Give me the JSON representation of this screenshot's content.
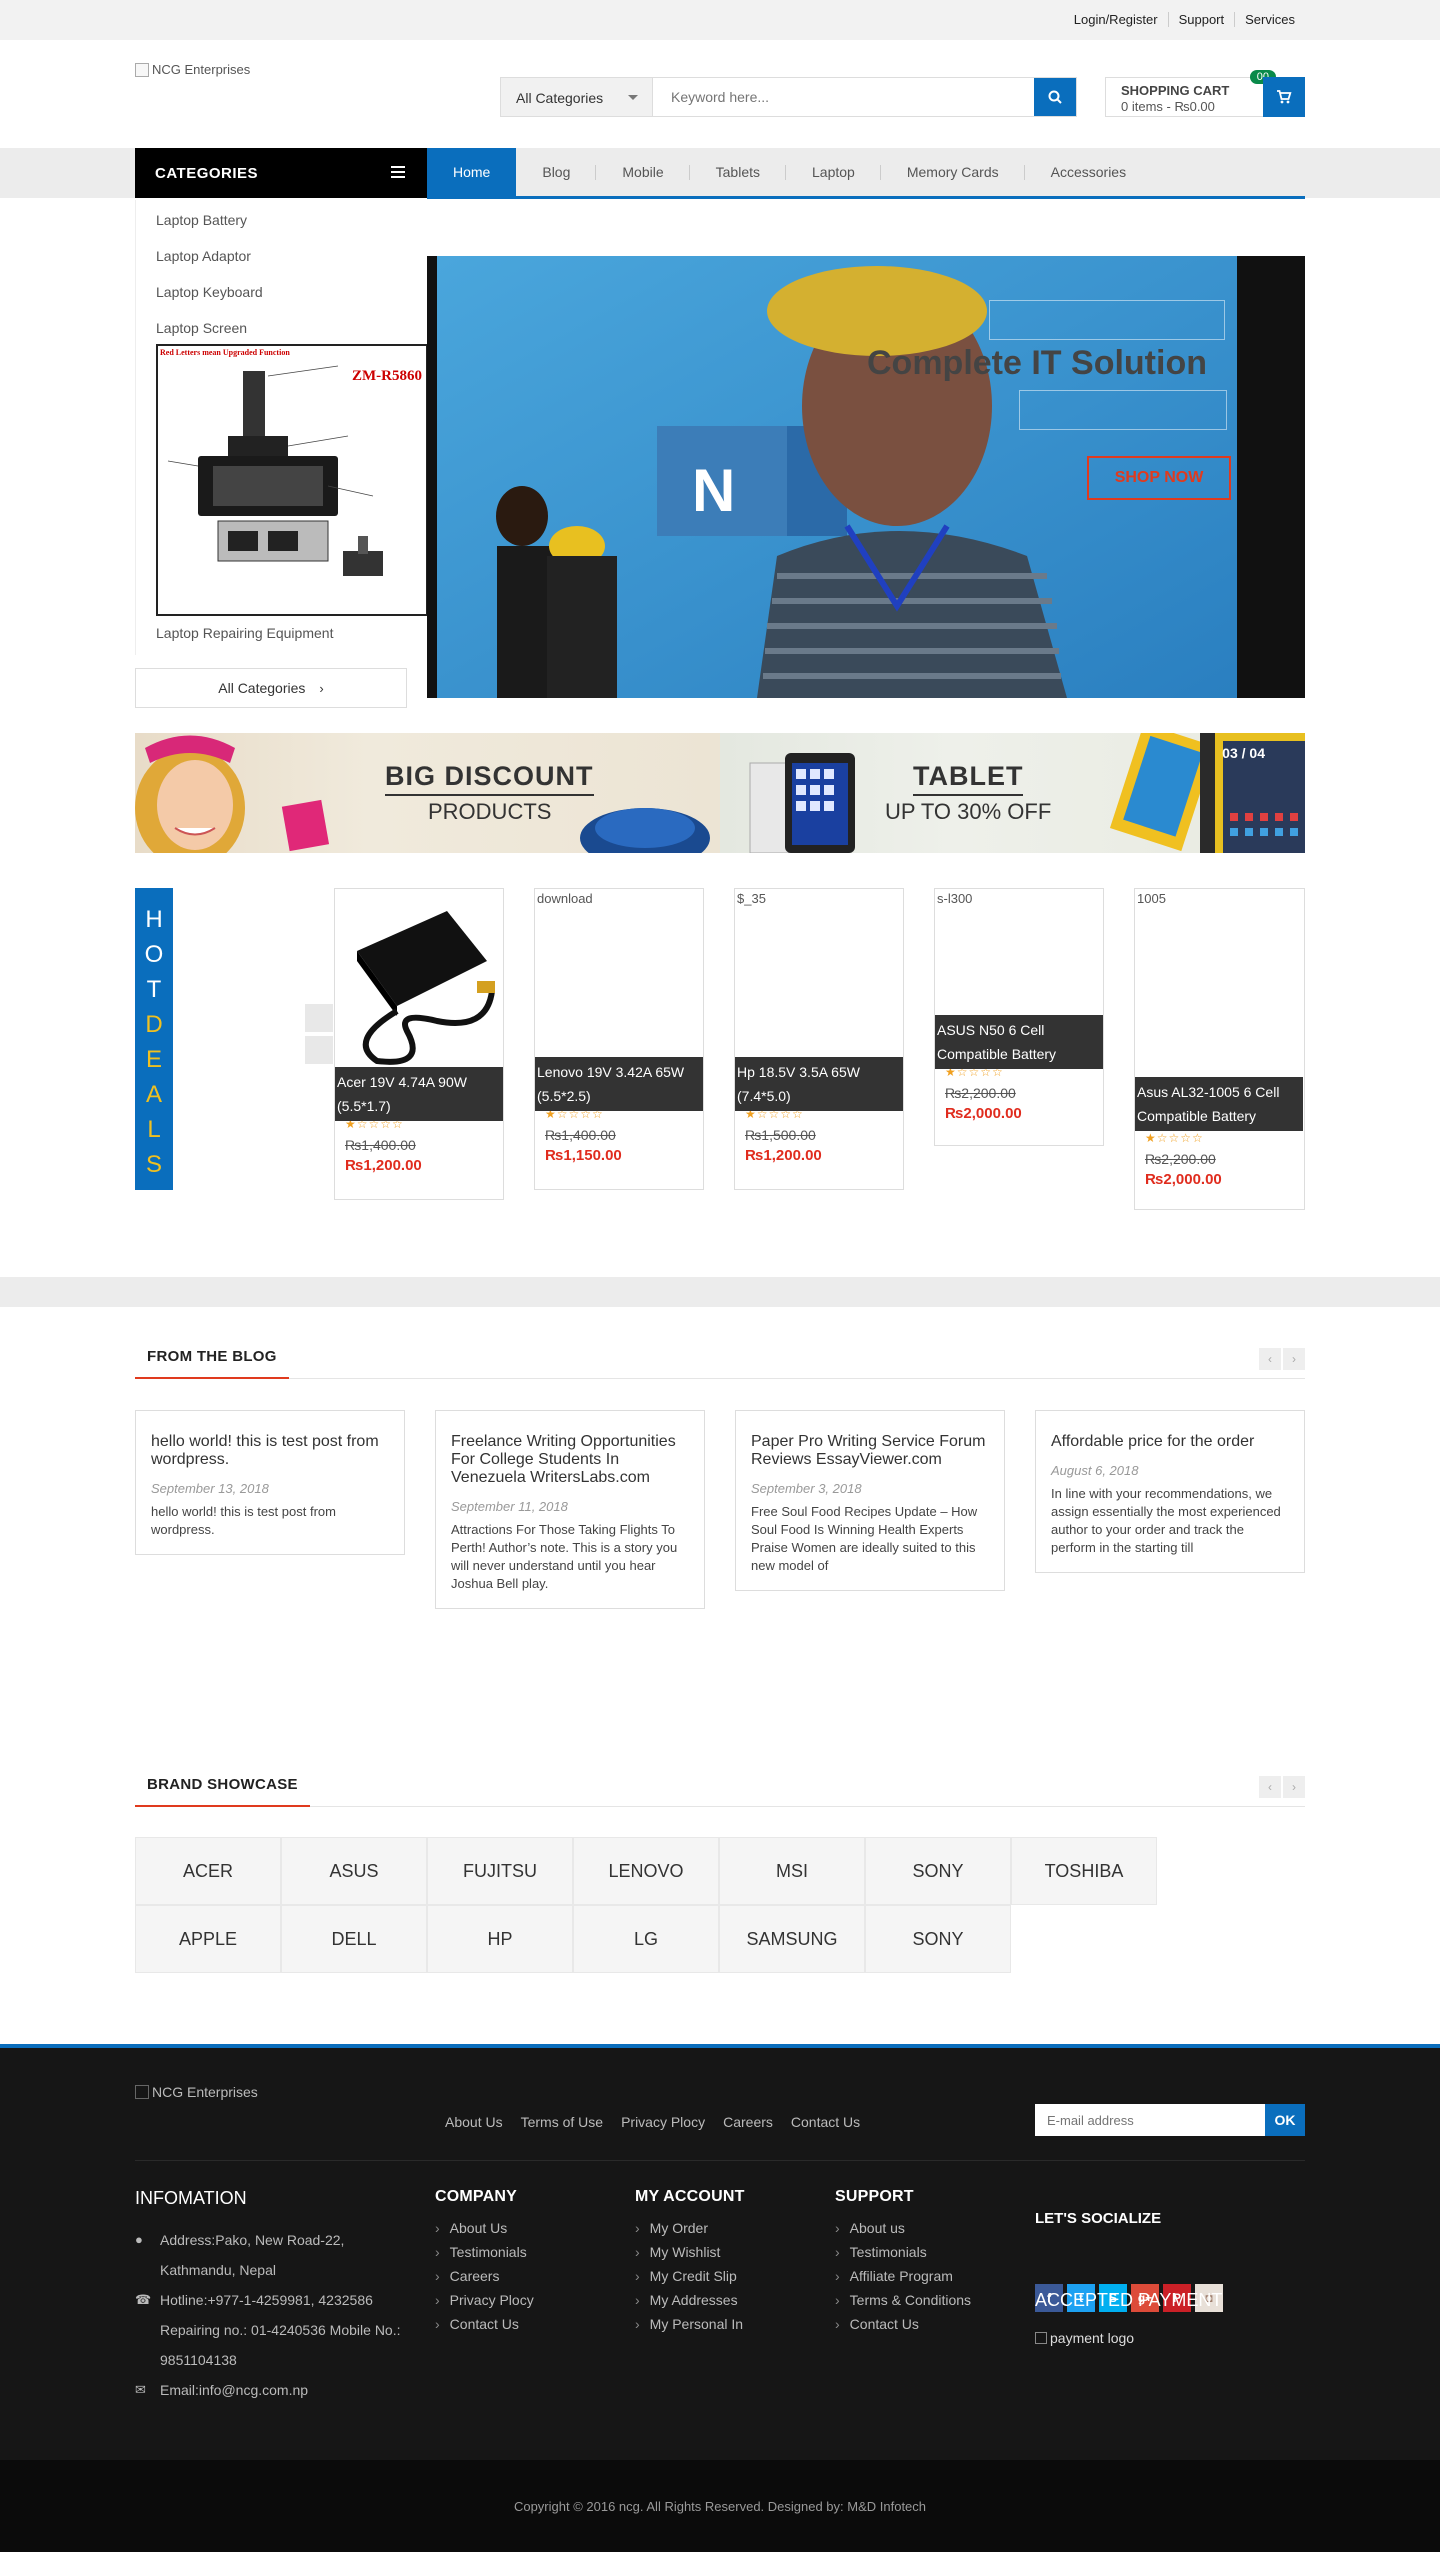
{
  "topbar": {
    "login": "Login/Register",
    "support": "Support",
    "services": "Services"
  },
  "header": {
    "logo_alt": "NCG Enterprises",
    "search_category": "All Categories",
    "search_placeholder": "Keyword here...",
    "cart_title": "SHOPPING CART",
    "cart_summary": "0 items - ₨0.00",
    "cart_count": "00"
  },
  "nav": {
    "categories_label": "CATEGORIES",
    "items": [
      "Home",
      "Blog",
      "Mobile",
      "Tablets",
      "Laptop",
      "Memory Cards",
      "Accessories"
    ]
  },
  "categories": {
    "items": [
      "Laptop Battery",
      "Laptop Adaptor",
      "Laptop Keyboard",
      "Laptop Screen",
      "Laptop Repairing Equipment"
    ],
    "all_label": "All Categories",
    "image_model": "ZM-R5860",
    "image_caption": "Red Letters mean Upgraded Function"
  },
  "hero": {
    "title": "Complete IT Solution",
    "cta": "SHOP NOW"
  },
  "banners": {
    "discount_title": "BIG DISCOUNT",
    "discount_sub": "PRODUCTS",
    "tablet_title": "TABLET",
    "tablet_sub": "UP TO 30% OFF",
    "pager": "03 / 04"
  },
  "hotdeals": {
    "letters": [
      "H",
      "O",
      "T",
      "D",
      "E",
      "A",
      "L",
      "S"
    ],
    "products": [
      {
        "img_alt": "",
        "name": "Acer 19V 4.74A 90W (5.5*1.7)",
        "stars": "★☆☆☆☆",
        "old_price": "₨1,400.00",
        "price": "₨1,200.00"
      },
      {
        "img_alt": "download",
        "name": "Lenovo 19V 3.42A 65W (5.5*2.5)",
        "stars": "★☆☆☆☆",
        "old_price": "₨1,400.00",
        "price": "₨1,150.00"
      },
      {
        "img_alt": "$_35",
        "name": "Hp 18.5V 3.5A 65W (7.4*5.0)",
        "stars": "★☆☆☆☆",
        "old_price": "₨1,500.00",
        "price": "₨1,200.00"
      },
      {
        "img_alt": "s-l300",
        "name": "ASUS N50 6 Cell Compatible Battery",
        "stars": "★☆☆☆☆",
        "old_price": "₨2,200.00",
        "price": "₨2,000.00"
      },
      {
        "img_alt": "1005",
        "name": "Asus AL32-1005 6 Cell Compatible Battery",
        "stars": "★☆☆☆☆",
        "old_price": "₨2,200.00",
        "price": "₨2,000.00"
      }
    ]
  },
  "blog": {
    "heading": "FROM THE BLOG",
    "posts": [
      {
        "title": "hello world! this is test post from wordpress.",
        "date": "September 13, 2018",
        "excerpt": "hello world! this is test post from wordpress."
      },
      {
        "title": "Freelance Writing Opportunities For College Students In Venezuela WritersLabs.com",
        "date": "September 11, 2018",
        "excerpt": "Attractions For Those Taking Flights To Perth! Author’s note. This is a story you will never understand until you hear Joshua Bell play."
      },
      {
        "title": "Paper Pro Writing Service Forum Reviews EssayViewer.com",
        "date": "September 3, 2018",
        "excerpt": "Free Soul Food Recipes Update – How Soul Food Is Winning Health Experts Praise Women are ideally suited to this new model of"
      },
      {
        "title": "Affordable price for the order",
        "date": "August 6, 2018",
        "excerpt": "In line with your recommendations, we assign essentially the most experienced author to your order and track the perform in the starting till"
      }
    ]
  },
  "brands": {
    "heading": "BRAND SHOWCASE",
    "row1": [
      "ACER",
      "ASUS",
      "FUJITSU",
      "LENOVO",
      "MSI",
      "SONY",
      "TOSHIBA"
    ],
    "row2": [
      "APPLE",
      "DELL",
      "HP",
      "LG",
      "SAMSUNG",
      "SONY"
    ]
  },
  "footer": {
    "logo_alt": "NCG Enterprises",
    "links": [
      "About Us",
      "Terms of Use",
      "Privacy Plocy",
      "Careers",
      "Contact Us"
    ],
    "email_placeholder": "E-mail address",
    "email_btn": "OK",
    "info_heading": "INFOMATION",
    "address": "Address:Pako, New Road-22, Kathmandu, Nepal",
    "hotline": "Hotline:+977-1-4259981, 4232586 Repairing no.: 01-4240536 Mobile No.: 9851104138",
    "email": "Email:info@ncg.com.np",
    "company_heading": "COMPANY",
    "company": [
      "About Us",
      "Testimonials",
      "Careers",
      "Privacy Plocy",
      "Contact Us"
    ],
    "account_heading": "MY ACCOUNT",
    "account": [
      "My Order",
      "My Wishlist",
      "My Credit Slip",
      "My Addresses",
      "My Personal In"
    ],
    "support_heading": "SUPPORT",
    "support": [
      "About us",
      "Testimonials",
      "Affiliate Program",
      "Terms & Conditions",
      "Contact Us"
    ],
    "social_heading": "LET'S SOCIALIZE",
    "social": [
      "facebook-icon",
      "twitter-icon",
      "skype-icon",
      "google-plus-icon",
      "pinterest-icon",
      "instagram-icon"
    ],
    "payment_heading": "ACCEPTED PAYMENT",
    "payment_alt": "payment logo",
    "copyright": "Copyright © 2016 ncg. All Rights Reserved. Designed by: M&D Infotech"
  },
  "colors": {
    "accent": "#0a6ebd",
    "price": "#e02c1e",
    "cta": "#e03a1e",
    "dark": "#161616"
  }
}
